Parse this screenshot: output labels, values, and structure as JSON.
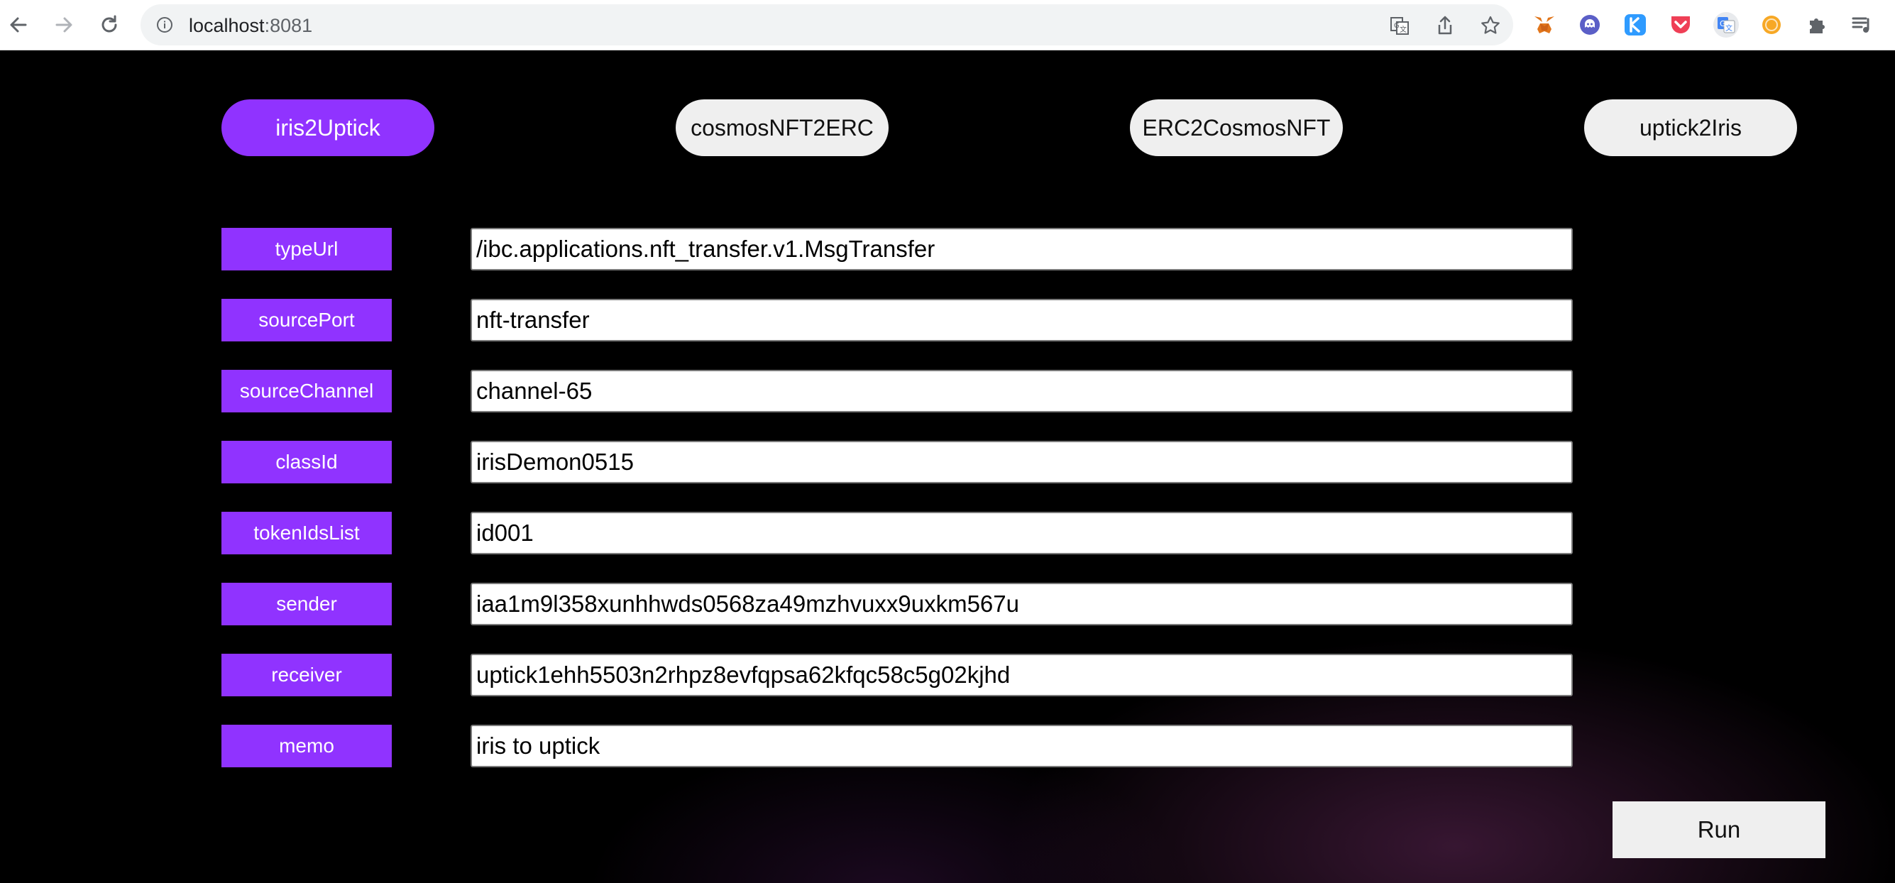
{
  "browser": {
    "url_host": "localhost",
    "url_port": ":8081",
    "icons": {
      "back": "arrow-left-icon",
      "forward": "arrow-right-icon",
      "reload": "reload-icon",
      "site_info": "info-icon",
      "translate": "translate-icon",
      "share": "share-icon",
      "bookmark": "star-icon",
      "extensions": [
        "metamask-icon",
        "ghost-extension-icon",
        "keplr-icon",
        "pocket-icon",
        "google-translate-icon",
        "orange-extension-icon",
        "puzzle-icon",
        "media-icon"
      ]
    }
  },
  "tabs": [
    {
      "label": "iris2Uptick",
      "active": true
    },
    {
      "label": "cosmosNFT2ERC",
      "active": false
    },
    {
      "label": "ERC2CosmosNFT",
      "active": false
    },
    {
      "label": "uptick2Iris",
      "active": false
    }
  ],
  "form": {
    "fields": [
      {
        "label": "typeUrl",
        "value": "/ibc.applications.nft_transfer.v1.MsgTransfer"
      },
      {
        "label": "sourcePort",
        "value": "nft-transfer"
      },
      {
        "label": "sourceChannel",
        "value": "channel-65"
      },
      {
        "label": "classId",
        "value": "irisDemon0515"
      },
      {
        "label": "tokenIdsList",
        "value": "id001"
      },
      {
        "label": "sender",
        "value": "iaa1m9l358xunhhwds0568za49mzhvuxx9uxkm567u"
      },
      {
        "label": "receiver",
        "value": "uptick1ehh5503n2rhpz8evfqpsa62kfqc58c5g02kjhd"
      },
      {
        "label": "memo",
        "value": "iris to uptick"
      }
    ],
    "run_label": "Run"
  },
  "colors": {
    "accent": "#9033ff",
    "tab_inactive": "#efefef",
    "background": "#000000"
  }
}
